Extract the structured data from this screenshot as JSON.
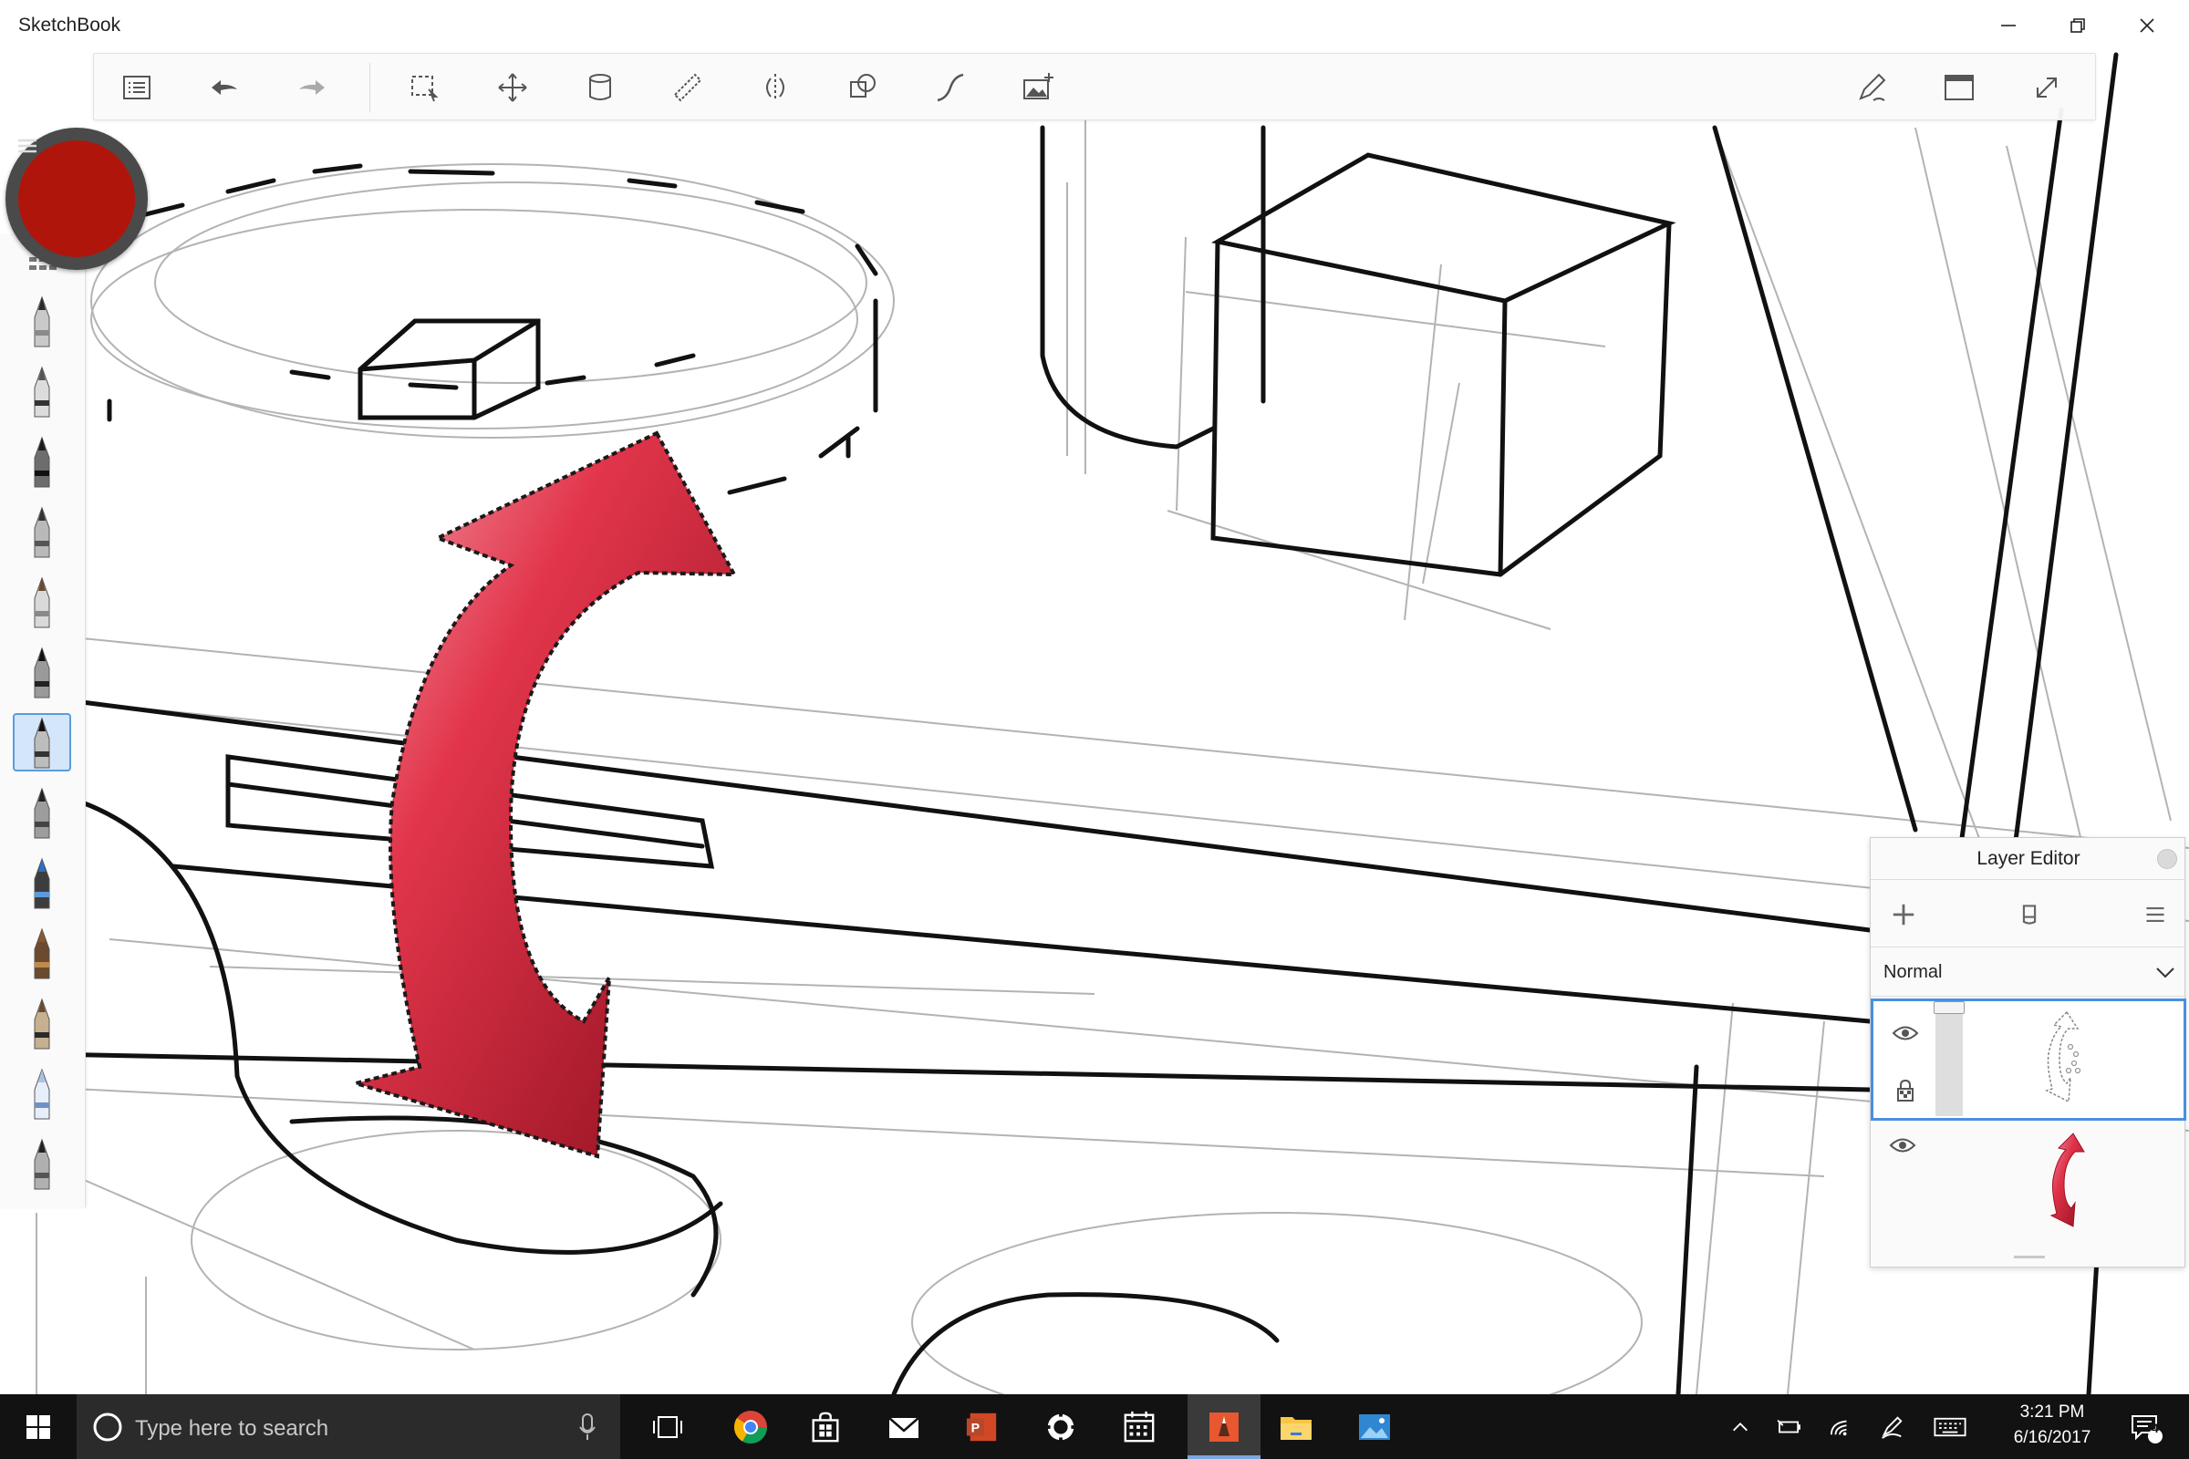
{
  "app": {
    "title": "SketchBook"
  },
  "window_controls": [
    {
      "name": "minimize-button",
      "icon": "minimize-icon"
    },
    {
      "name": "restore-button",
      "icon": "restore-icon"
    },
    {
      "name": "close-button",
      "icon": "close-icon"
    }
  ],
  "toolbar": {
    "left_tools": [
      "menu-list-icon",
      "undo-icon",
      "redo-icon"
    ],
    "tools": [
      "select-icon",
      "transform-icon",
      "fill-icon",
      "ruler-icon",
      "symmetry-icon",
      "shapes-icon",
      "curve-icon",
      "add-image-icon"
    ],
    "right_tools": [
      "pen-mode-icon",
      "ui-layout-icon",
      "fullscreen-icon"
    ]
  },
  "color_puck": {
    "color": "#b0150c"
  },
  "brush_palette": {
    "selected_index": 6,
    "brushes": [
      "pencil",
      "airbrush",
      "marker",
      "chisel-marker",
      "paintbrush",
      "inking-pen",
      "fountain-pen",
      "ballpoint-pen",
      "highlighter",
      "brush-pen",
      "pastel",
      "blender",
      "fine-liner"
    ]
  },
  "layer_editor": {
    "title": "Layer Editor",
    "blend_mode": "Normal",
    "actions": [
      "add-layer-icon",
      "layer-canvas-icon",
      "layer-menu-icon"
    ],
    "layers": [
      {
        "name": "selection-layer",
        "visible": true,
        "selected": true,
        "opacity": 1.0
      },
      {
        "name": "arrow-layer",
        "visible": true,
        "selected": false
      }
    ]
  },
  "taskbar": {
    "search_placeholder": "Type here to search",
    "time": "3:21 PM",
    "date": "6/16/2017",
    "notification_count": "4",
    "apps": [
      "task-view-icon",
      "chrome-icon",
      "store-icon",
      "mail-icon",
      "powerpoint-icon",
      "settings-app-icon",
      "calendar-icon",
      "sketchbook-icon",
      "file-explorer-icon",
      "photos-icon"
    ]
  },
  "colors": {
    "accent_blue": "#4a8fe0",
    "arrow_red": "#d8283c",
    "taskbar_bg": "#121212"
  }
}
